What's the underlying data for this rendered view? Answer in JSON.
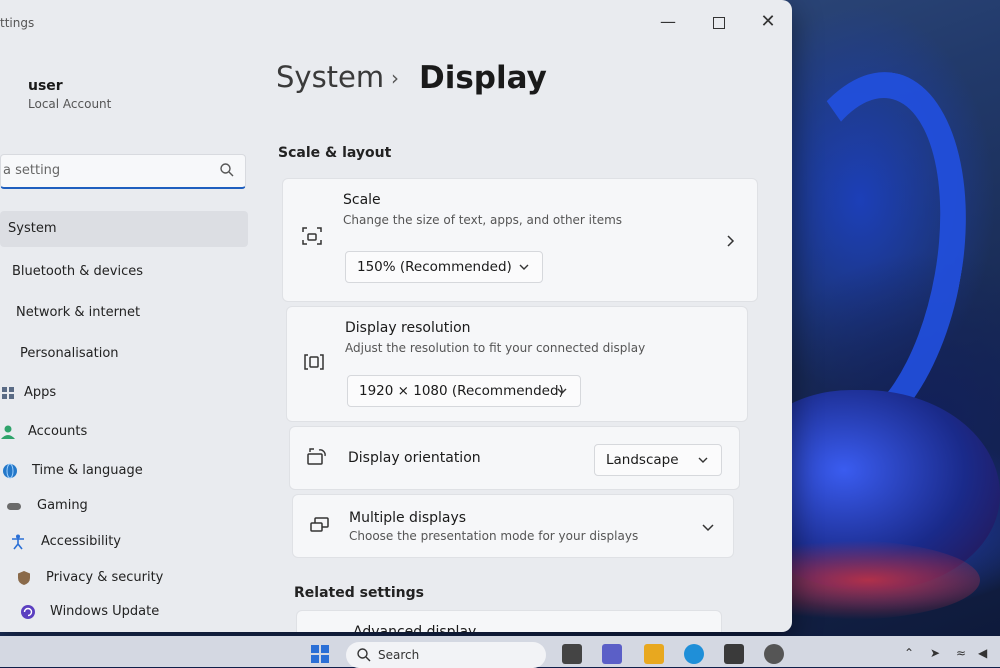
{
  "window": {
    "app_title": "ttings"
  },
  "sidebar": {
    "user_name": "user",
    "user_type": "Local Account",
    "search_placeholder": "a setting",
    "items": [
      {
        "label": "System",
        "icon": "monitor-icon",
        "color": "#0067c0"
      },
      {
        "label": "Bluetooth & devices",
        "icon": "bluetooth-icon",
        "color": "#0067c0"
      },
      {
        "label": "Network & internet",
        "icon": "wifi-icon",
        "color": "#5a6b85"
      },
      {
        "label": "Personalisation",
        "icon": "brush-icon",
        "color": "#c46b2e"
      },
      {
        "label": "Apps",
        "icon": "apps-icon",
        "color": "#5a6b85"
      },
      {
        "label": "Accounts",
        "icon": "person-icon",
        "color": "#2fa36b"
      },
      {
        "label": "Time & language",
        "icon": "globe-icon",
        "color": "#2478c9"
      },
      {
        "label": "Gaming",
        "icon": "gamepad-icon",
        "color": "#6b6b6b"
      },
      {
        "label": "Accessibility",
        "icon": "accessibility-icon",
        "color": "#2a6fd6"
      },
      {
        "label": "Privacy & security",
        "icon": "shield-icon",
        "color": "#8a6a4a"
      },
      {
        "label": "Windows Update",
        "icon": "update-icon",
        "color": "#5b3fc0"
      }
    ]
  },
  "header": {
    "crumb_parent": "System",
    "crumb_sep": "›",
    "crumb_current": "Display"
  },
  "scale_layout": {
    "title": "Scale & layout",
    "scale": {
      "title": "Scale",
      "desc": "Change the size of text, apps, and other items",
      "value": "150% (Recommended)"
    },
    "resolution": {
      "title": "Display resolution",
      "desc": "Adjust the resolution to fit your connected display",
      "value": "1920 × 1080 (Recommended)"
    },
    "orientation": {
      "title": "Display orientation",
      "value": "Landscape"
    },
    "multiple": {
      "title": "Multiple displays",
      "desc": "Choose the presentation mode for your displays"
    }
  },
  "related": {
    "title": "Related settings",
    "advanced": "Advanced display"
  },
  "taskbar": {
    "search_label": "Search"
  },
  "colors": {
    "accent": "#1f5fbf",
    "window_bg": "#e9ebef",
    "card_bg": "#f6f7f9"
  }
}
